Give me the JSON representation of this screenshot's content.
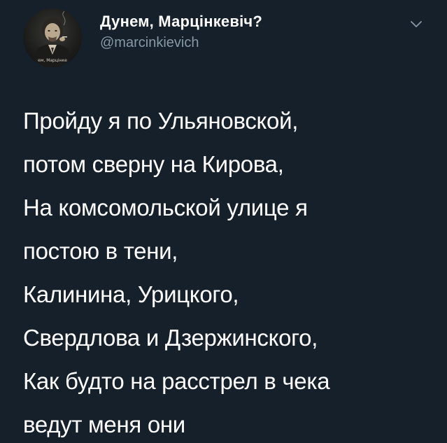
{
  "author": {
    "display_name": "Дунем, Марцінкевіч?",
    "handle": "@marcinkievich",
    "avatar_caption": "ем, Марцінке"
  },
  "menu": {
    "icon": "chevron-down-icon"
  },
  "tweet": {
    "lines": [
      "Пройду я по Ульяновской,",
      "потом сверну на Кирова,",
      "На комсомольской улице я",
      "постою в тени,",
      "Калинина, Урицкого,",
      "Свердлова и Дзержинского,",
      "Как будто на расстрел в чека",
      "ведут меня они"
    ]
  },
  "colors": {
    "background": "#15202b",
    "primary_text": "#ffffff",
    "secondary_text": "#8899a6"
  }
}
